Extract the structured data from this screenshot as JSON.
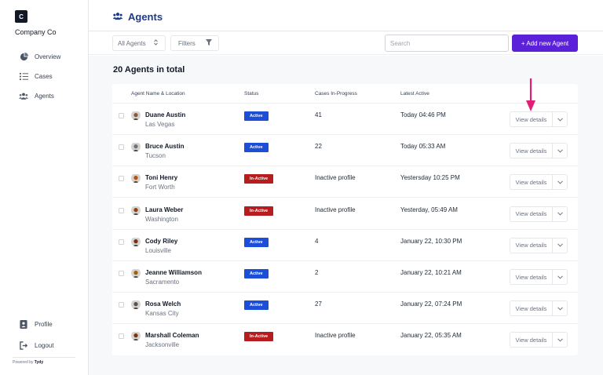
{
  "sidebar": {
    "logo_letter": "C",
    "company": "Company Co",
    "nav": [
      {
        "label": "Overview",
        "icon": "pie-chart-icon"
      },
      {
        "label": "Cases",
        "icon": "list-icon"
      },
      {
        "label": "Agents",
        "icon": "users-icon"
      }
    ],
    "bottom": [
      {
        "label": "Profile",
        "icon": "profile-icon"
      },
      {
        "label": "Logout",
        "icon": "logout-icon"
      }
    ],
    "powered_prefix": "Powered by",
    "powered_brand": "Tydy"
  },
  "header": {
    "title": "Agents",
    "icon": "users-icon"
  },
  "toolbar": {
    "agent_select": "All Agents",
    "filters_label": "Filters",
    "search_placeholder": "Search",
    "add_button": "+ Add new Agent"
  },
  "main": {
    "total_label": "20 Agents in total",
    "columns": [
      "Agent Name & Location",
      "Status",
      "Cases In-Progress",
      "Latest Active"
    ],
    "view_details_label": "View details",
    "rows": [
      {
        "name": "Duane Austin",
        "location": "Las Vegas",
        "status": "Active",
        "status_type": "active",
        "cases": "41",
        "last_active": "Today 04:46 PM"
      },
      {
        "name": "Bruce Austin",
        "location": "Tucson",
        "status": "Active",
        "status_type": "active",
        "cases": "22",
        "last_active": "Today 05:33 AM"
      },
      {
        "name": "Toni Henry",
        "location": "Fort Worth",
        "status": "In-Active",
        "status_type": "inactive",
        "cases": "Inactive profile",
        "last_active": "Yestersday 10:25 PM"
      },
      {
        "name": "Laura Weber",
        "location": "Washington",
        "status": "In-Active",
        "status_type": "inactive",
        "cases": "Inactive profile",
        "last_active": "Yesterday, 05:49 AM"
      },
      {
        "name": "Cody Riley",
        "location": "Louisville",
        "status": "Active",
        "status_type": "active",
        "cases": "4",
        "last_active": "January 22, 10:30 PM"
      },
      {
        "name": "Jeanne Williamson",
        "location": "Sacramento",
        "status": "Active",
        "status_type": "active",
        "cases": "2",
        "last_active": "January 22, 10:21 AM"
      },
      {
        "name": "Rosa Welch",
        "location": "Kansas City",
        "status": "Active",
        "status_type": "active",
        "cases": "27",
        "last_active": "January 22, 07:24 PM"
      },
      {
        "name": "Marshall Coleman",
        "location": "Jacksonville",
        "status": "In-Active",
        "status_type": "inactive",
        "cases": "Inactive profile",
        "last_active": "January 22, 05:35 AM"
      }
    ]
  },
  "colors": {
    "accent": "#5b21d9",
    "title": "#1e3a8a",
    "active": "#1d4ed8",
    "inactive": "#b91c1c",
    "arrow": "#e11d74"
  }
}
